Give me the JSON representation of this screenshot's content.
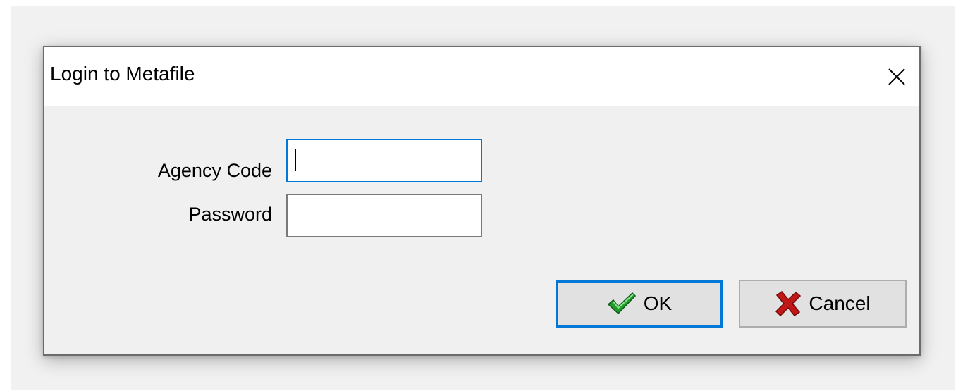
{
  "dialog": {
    "title": "Login to Metafile",
    "close_icon": "close-icon"
  },
  "form": {
    "agency_code": {
      "label": "Agency Code",
      "value": ""
    },
    "password": {
      "label": "Password",
      "value": ""
    }
  },
  "buttons": {
    "ok": {
      "label": "OK",
      "icon": "checkmark-icon",
      "icon_color": "#1f9e2b"
    },
    "cancel": {
      "label": "Cancel",
      "icon": "red-x-icon",
      "icon_color": "#c01818"
    }
  },
  "colors": {
    "focus_accent": "#0078d7",
    "dialog_background": "#f0f0f0",
    "titlebar_background": "#ffffff"
  }
}
